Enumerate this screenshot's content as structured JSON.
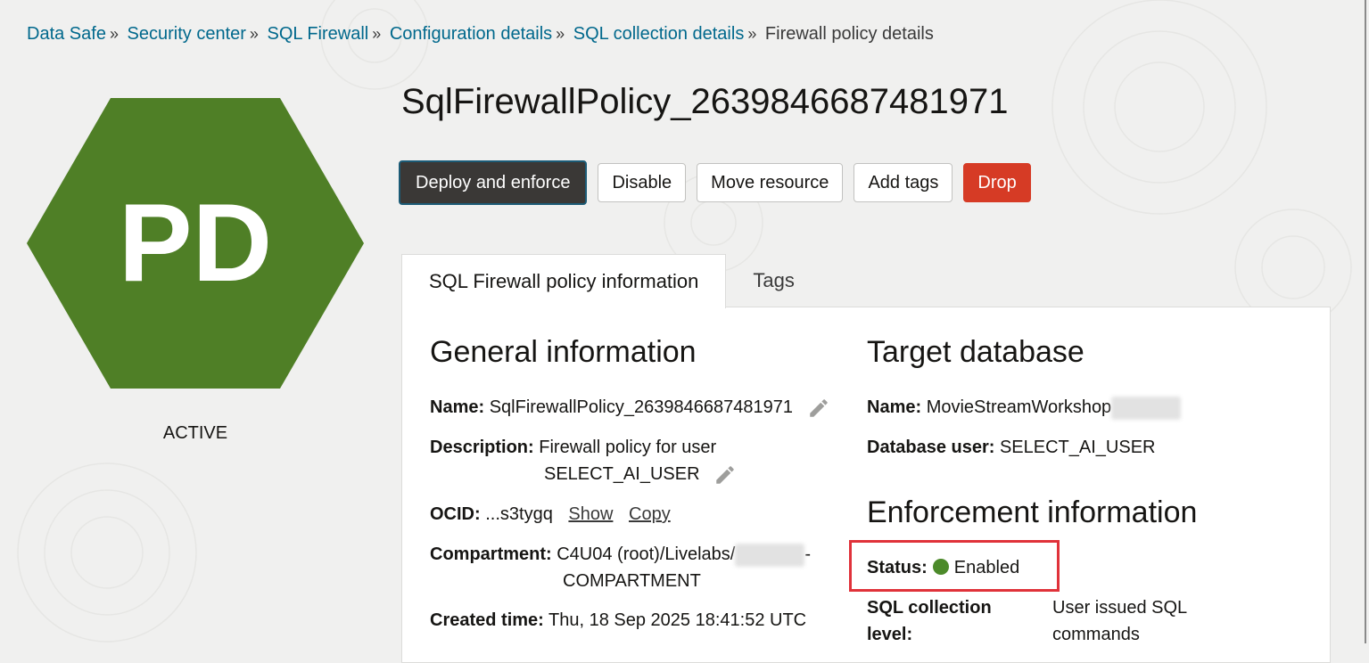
{
  "breadcrumb": {
    "items": [
      "Data Safe",
      "Security center",
      "SQL Firewall",
      "Configuration details",
      "SQL collection details"
    ],
    "current": "Firewall policy details",
    "separator": "»"
  },
  "resource_icon": {
    "initials": "PD",
    "color": "#4f7f26",
    "state": "ACTIVE"
  },
  "page_title": "SqlFirewallPolicy_2639846687481971",
  "actions": {
    "deploy_label": "Deploy and enforce",
    "disable_label": "Disable",
    "move_label": "Move resource",
    "add_tags_label": "Add tags",
    "drop_label": "Drop"
  },
  "tabs": {
    "info": "SQL Firewall policy information",
    "tags": "Tags"
  },
  "general": {
    "heading": "General information",
    "name_label": "Name:",
    "name_value": "SqlFirewallPolicy_2639846687481971",
    "description_label": "Description:",
    "description_line1": "Firewall policy for user",
    "description_line2": "SELECT_AI_USER",
    "ocid_label": "OCID:",
    "ocid_value": "...s3tygq",
    "ocid_show": "Show",
    "ocid_copy": "Copy",
    "compartment_label": "Compartment:",
    "compartment_line1": "C4U04 (root)/Livelabs/",
    "compartment_dash": "-",
    "compartment_line2": "COMPARTMENT",
    "created_label": "Created time:",
    "created_value": "Thu, 18 Sep 2025 18:41:52 UTC"
  },
  "target": {
    "heading": "Target database",
    "name_label": "Name:",
    "name_value": "MovieStreamWorkshop",
    "db_user_label": "Database user:",
    "db_user_value": "SELECT_AI_USER"
  },
  "enforcement": {
    "heading": "Enforcement information",
    "status_label": "Status:",
    "status_value": "Enabled",
    "status_color": "#4c8a2a",
    "collection_label_line1": "SQL collection",
    "collection_label_line2": "level:",
    "collection_value_line1": "User issued SQL",
    "collection_value_line2": "commands"
  },
  "colors": {
    "link": "#00688c",
    "drop": "#d63b25",
    "primary": "#3a3836",
    "highlight": "#e0323a"
  }
}
